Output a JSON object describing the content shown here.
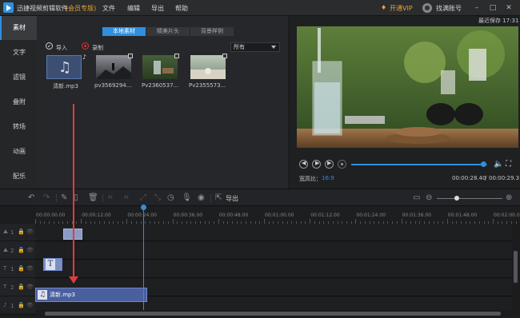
{
  "titlebar": {
    "app_name": "迅捷视频剪辑软件",
    "edition": "(会员专版)",
    "menu": [
      "文件",
      "编辑",
      "导出",
      "帮助"
    ],
    "vip_label": "开通VIP",
    "account_label": "找满账号",
    "autosave": "最近保存 17:31"
  },
  "leftnav": {
    "items": [
      "素材",
      "文字",
      "滤镜",
      "叠附",
      "转场",
      "动画",
      "配乐"
    ],
    "active_index": 0
  },
  "media": {
    "tabs": [
      "本地素材",
      "精美片头",
      "背景样例"
    ],
    "active_tab": 0,
    "filter_value": "所有",
    "import_label": "导入",
    "record_label": "录制",
    "items": [
      {
        "name": "清新.mp3",
        "kind": "audio"
      },
      {
        "name": "pv3569294...",
        "kind": "video"
      },
      {
        "name": "Pv2360537...",
        "kind": "video"
      },
      {
        "name": "Pv2355573...",
        "kind": "video"
      }
    ]
  },
  "preview": {
    "current_time": "00:00:28.40",
    "total_time": "00:00:29.31",
    "aspect_label": "宽高比：",
    "aspect_value": "16:9",
    "progress": 0.97
  },
  "toolbar": {
    "export_label": "导出"
  },
  "timeline": {
    "ticks": [
      "00:00:00.00",
      "00:00:12.00",
      "00:00:24.00",
      "00:00:36.00",
      "00:00:48.00",
      "00:01:00.00",
      "00:01:12.00",
      "00:01:24.00",
      "00:01:36.00",
      "00:01:48.00",
      "00:02:00.00"
    ],
    "tracks": [
      {
        "index": "1"
      },
      {
        "index": "2"
      },
      {
        "index": "1"
      },
      {
        "index": "2"
      },
      {
        "index": "1"
      }
    ],
    "audio_clip_name": "清新.mp3",
    "text_clip_label": "T"
  }
}
